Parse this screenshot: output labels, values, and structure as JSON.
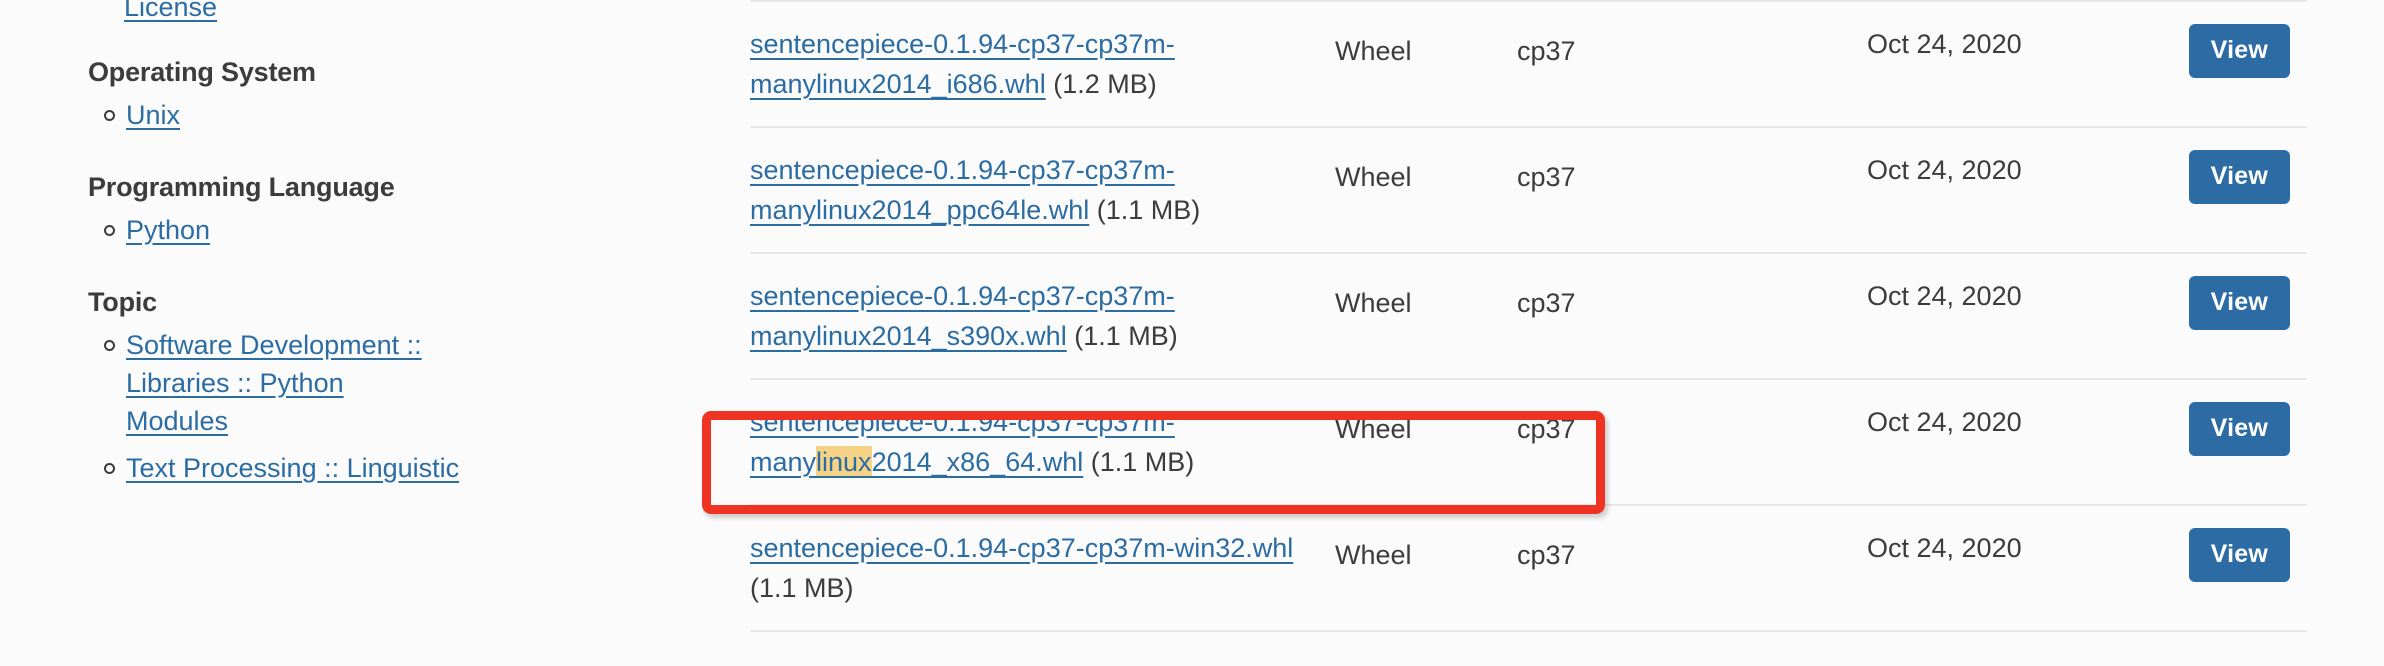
{
  "sidebar": {
    "top_link": "License",
    "groups": [
      {
        "heading": "Operating System",
        "items": [
          {
            "label": "Unix",
            "wrap": false
          }
        ]
      },
      {
        "heading": "Programming Language",
        "items": [
          {
            "label": "Python",
            "wrap": false
          }
        ]
      },
      {
        "heading": "Topic",
        "items": [
          {
            "label": "Software Development :: Libraries :: Python Modules",
            "wrap": true
          },
          {
            "label": "Text Processing :: Linguistic",
            "wrap": false
          }
        ]
      }
    ]
  },
  "files_table": {
    "action_label": "View",
    "rows": [
      {
        "filename": "sentencepiece-0.1.94-cp37-cp37m-manylinux2014_i686.whl",
        "filename_pre": "sentencepiece-0.1.94-cp37-cp37m-manylinux2014_i686.whl",
        "filename_highlight": "",
        "filename_post": "",
        "size": "(1.2 MB)",
        "type": "Wheel",
        "python_version": "cp37",
        "upload_date": "Oct 24, 2020",
        "highlighted": false
      },
      {
        "filename": "sentencepiece-0.1.94-cp37-cp37m-manylinux2014_ppc64le.whl",
        "filename_pre": "sentencepiece-0.1.94-cp37-cp37m-manylinux2014_ppc64le.whl",
        "filename_highlight": "",
        "filename_post": "",
        "size": "(1.1 MB)",
        "type": "Wheel",
        "python_version": "cp37",
        "upload_date": "Oct 24, 2020",
        "highlighted": false
      },
      {
        "filename": "sentencepiece-0.1.94-cp37-cp37m-manylinux2014_s390x.whl",
        "filename_pre": "sentencepiece-0.1.94-cp37-cp37m-manylinux2014_s390x.whl",
        "filename_highlight": "",
        "filename_post": "",
        "size": "(1.1 MB)",
        "type": "Wheel",
        "python_version": "cp37",
        "upload_date": "Oct 24, 2020",
        "highlighted": false
      },
      {
        "filename": "sentencepiece-0.1.94-cp37-cp37m-manylinux2014_x86_64.whl",
        "filename_pre": "sentencepiece-0.1.94-cp37-cp37m-many",
        "filename_highlight": "linux",
        "filename_post": "2014_x86_64.whl",
        "size": "(1.1 MB)",
        "type": "Wheel",
        "python_version": "cp37",
        "upload_date": "Oct 24, 2020",
        "highlighted": true
      },
      {
        "filename": "sentencepiece-0.1.94-cp37-cp37m-win32.whl",
        "filename_pre": "sentencepiece-0.1.94-cp37-cp37m-win32.whl",
        "filename_highlight": "",
        "filename_post": "",
        "size": "(1.1 MB)",
        "type": "Wheel",
        "python_version": "cp37",
        "upload_date": "Oct 24, 2020",
        "highlighted": false
      }
    ]
  },
  "annotation": {
    "box_color": "#ee3322",
    "highlight_color": "#f5d285",
    "link_color": "#2b6ca3",
    "button_color": "#2c6ba4"
  }
}
